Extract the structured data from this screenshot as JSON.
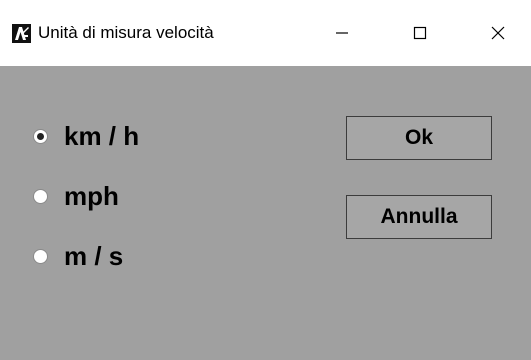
{
  "window": {
    "title": "Unità di misura velocità",
    "controls": {
      "minimize": "minimize",
      "maximize": "maximize",
      "close": "close"
    }
  },
  "speed_units": {
    "options": [
      {
        "label": "km / h",
        "selected": true
      },
      {
        "label": "mph",
        "selected": false
      },
      {
        "label": "m / s",
        "selected": false
      }
    ]
  },
  "buttons": {
    "ok_label": "Ok",
    "cancel_label": "Annulla"
  },
  "colors": {
    "titlebar": "#ffffff",
    "client_background": "#a0a0a0",
    "button_background": "#a6a6a6",
    "button_border": "#3c3c3c"
  }
}
